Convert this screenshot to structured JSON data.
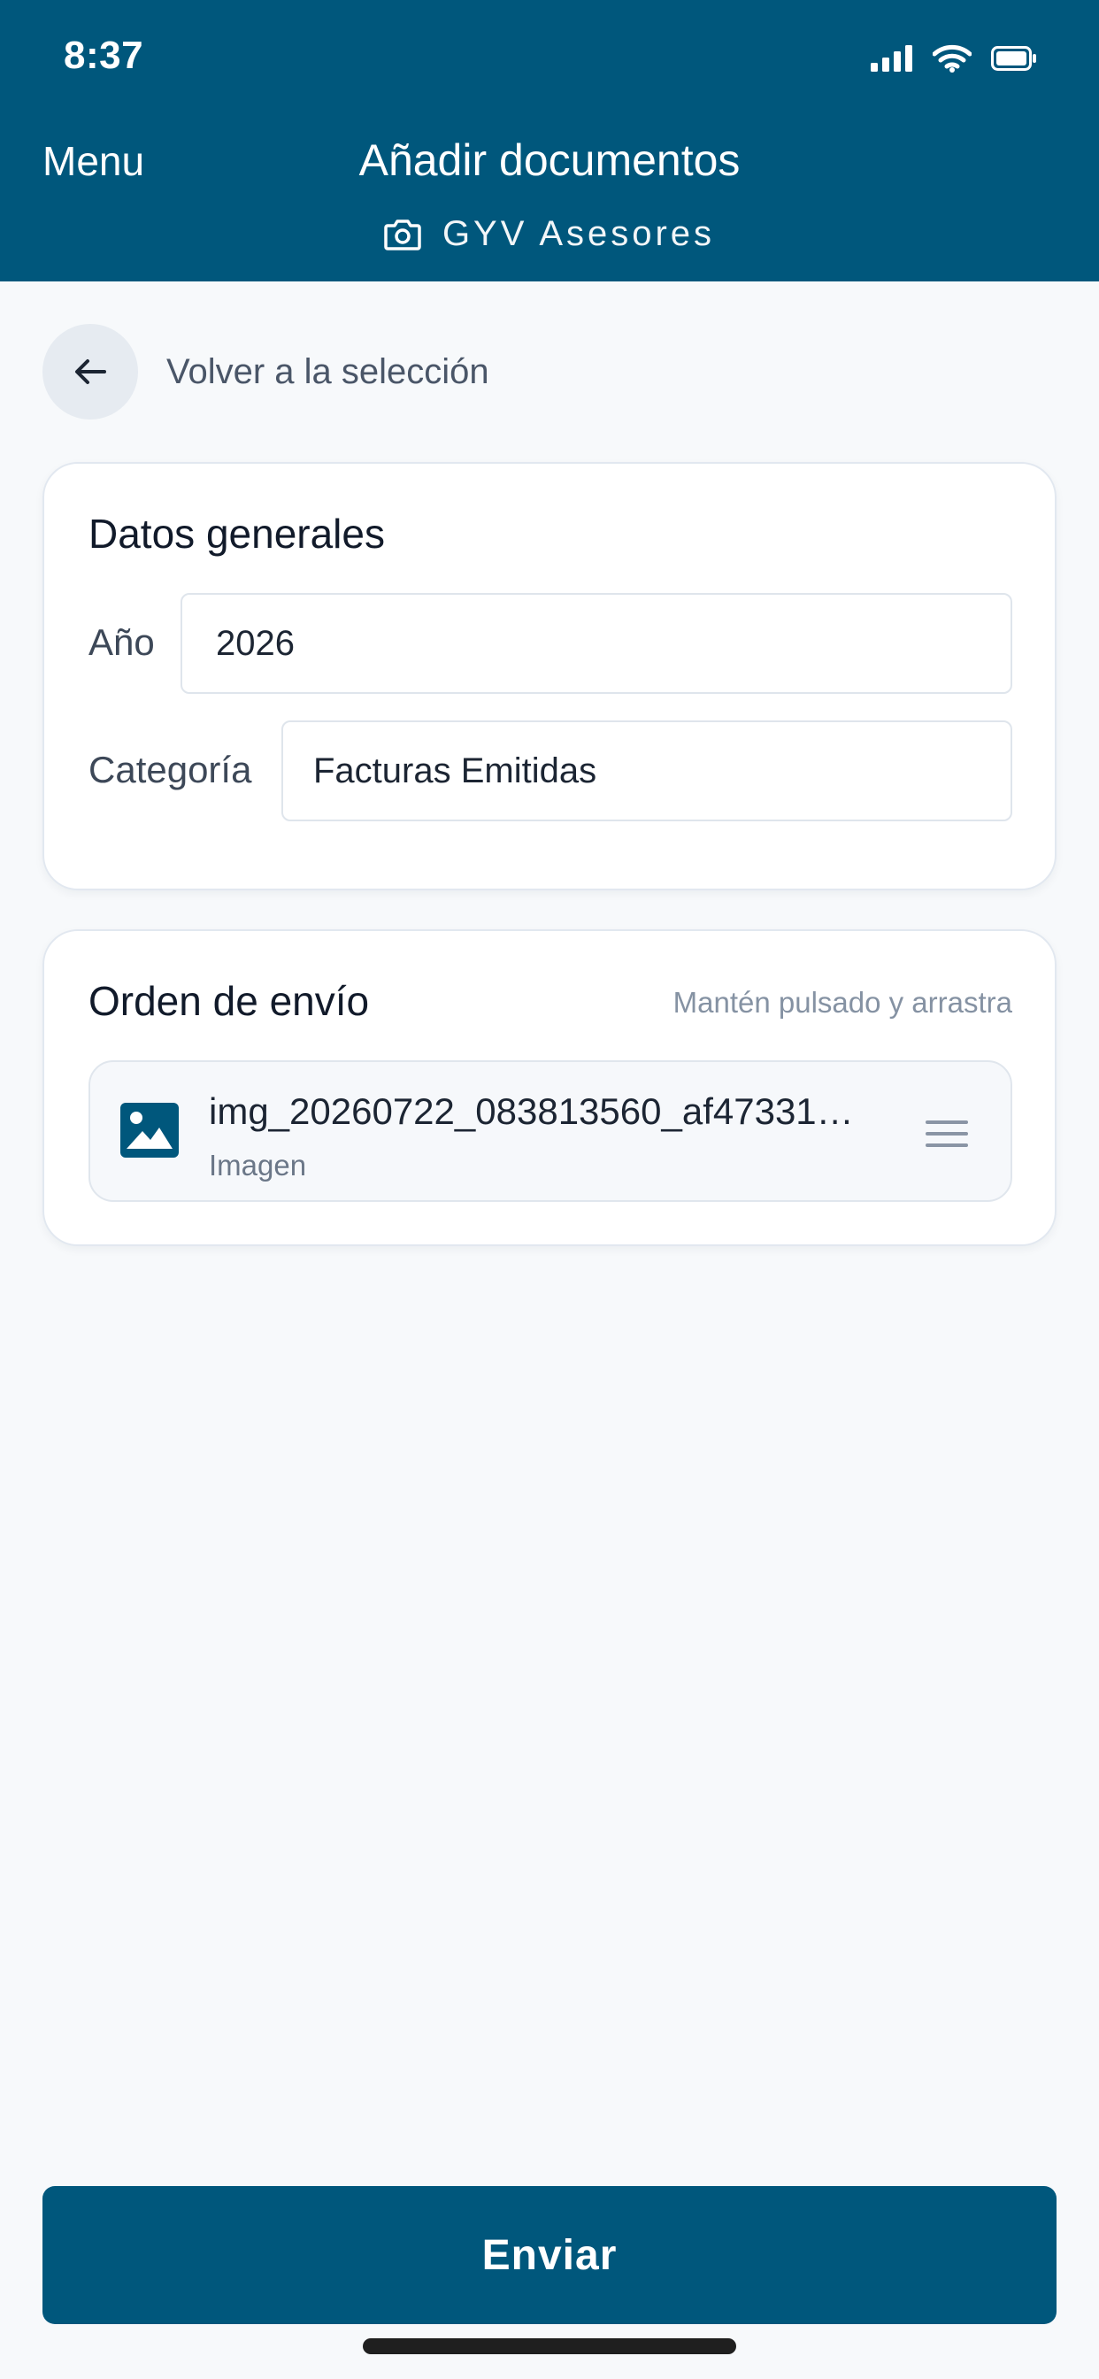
{
  "status_bar": {
    "time": "8:37"
  },
  "header": {
    "menu_label": "Menu",
    "title": "Añadir documentos",
    "subtitle": "GYV Asesores"
  },
  "back": {
    "label": "Volver a la selección"
  },
  "general": {
    "title": "Datos generales",
    "year_label": "Año",
    "year_value": "2026",
    "category_label": "Categoría",
    "category_value": "Facturas Emitidas"
  },
  "order": {
    "title": "Orden de envío",
    "hint": "Mantén pulsado y arrastra",
    "files": [
      {
        "name": "img_20260722_083813560_af47331…",
        "type": "Imagen"
      }
    ]
  },
  "send_label": "Enviar",
  "colors": {
    "brand": "#00577c",
    "background": "#f7f9fb"
  }
}
